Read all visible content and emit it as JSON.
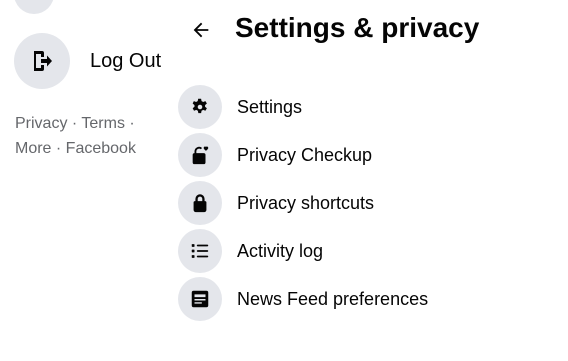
{
  "background_menu": {
    "logout": {
      "label": "Log Out",
      "icon": "logout-icon"
    },
    "footer": {
      "line1": "Privacy · Terms ·",
      "line2": "More · Facebook"
    }
  },
  "panel": {
    "title": "Settings & privacy",
    "back_icon": "back-arrow-icon",
    "items": [
      {
        "label": "Settings",
        "icon": "gear-icon"
      },
      {
        "label": "Privacy Checkup",
        "icon": "lock-heart-icon"
      },
      {
        "label": "Privacy shortcuts",
        "icon": "lock-icon"
      },
      {
        "label": "Activity log",
        "icon": "list-icon"
      },
      {
        "label": "News Feed preferences",
        "icon": "news-feed-icon"
      }
    ]
  },
  "colors": {
    "icon_bg": "#e4e6eb",
    "text_primary": "#050505",
    "text_secondary": "#65676b"
  }
}
